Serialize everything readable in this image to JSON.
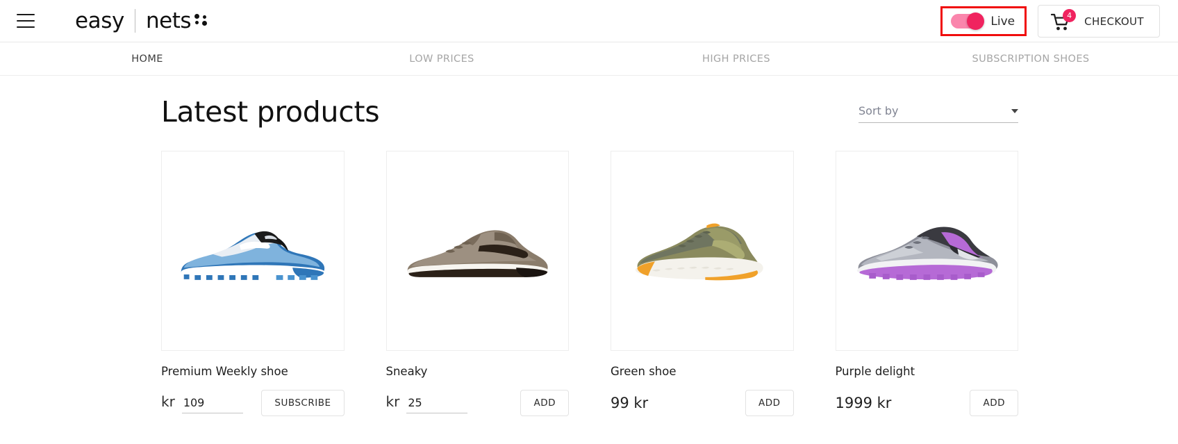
{
  "header": {
    "menu_icon": "hamburger-icon",
    "brand_primary": "easy",
    "brand_secondary": "nets",
    "live_toggle_label": "Live",
    "live_toggle_state": "on",
    "checkout_label": "CHECKOUT",
    "cart_count": "4",
    "cart_icon": "shopping-cart-icon",
    "accent_color": "#f0235f",
    "toggle_track_color": "#fa85ac",
    "highlight_color": "#f00d0d"
  },
  "nav": {
    "items": [
      {
        "label": "HOME",
        "active": true
      },
      {
        "label": "LOW PRICES",
        "active": false
      },
      {
        "label": "HIGH PRICES",
        "active": false
      },
      {
        "label": "SUBSCRIPTION SHOES",
        "active": false
      }
    ]
  },
  "main": {
    "title": "Latest products",
    "sort": {
      "label": "Sort by",
      "value": "",
      "caret_icon": "chevron-down-icon"
    },
    "products": [
      {
        "name": "Premium Weekly shoe",
        "currency": "kr",
        "price_value": "109",
        "price_editable": true,
        "price_display": "",
        "button_label": "SUBSCRIBE",
        "image_alt": "blue-running-shoe"
      },
      {
        "name": "Sneaky",
        "currency": "kr",
        "price_value": "25",
        "price_editable": true,
        "price_display": "",
        "button_label": "ADD",
        "image_alt": "brown-sneaker"
      },
      {
        "name": "Green shoe",
        "currency": "",
        "price_value": "",
        "price_editable": false,
        "price_display": "99 kr",
        "button_label": "ADD",
        "image_alt": "olive-knit-shoe"
      },
      {
        "name": "Purple delight",
        "currency": "",
        "price_value": "",
        "price_editable": false,
        "price_display": "1999 kr",
        "button_label": "ADD",
        "image_alt": "gray-purple-running-shoe"
      }
    ]
  }
}
